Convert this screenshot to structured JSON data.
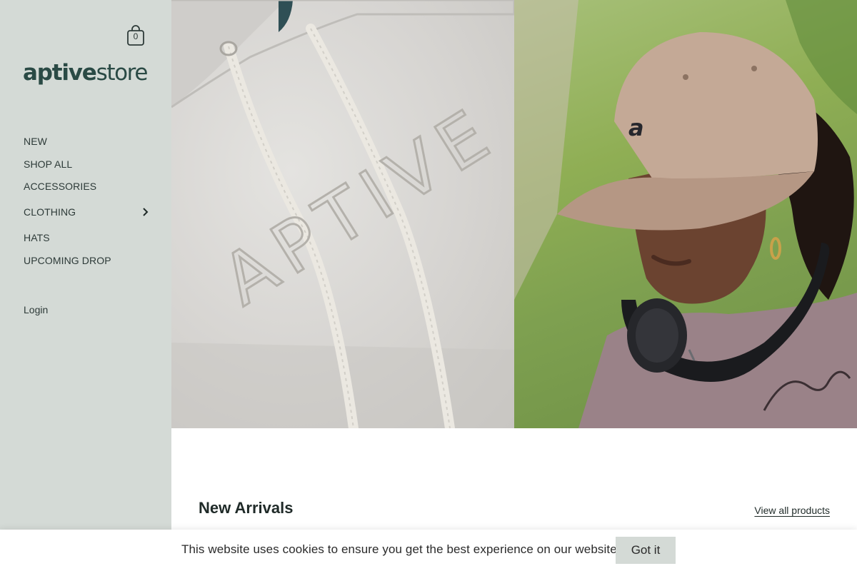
{
  "sidebar": {
    "cart_count": "0",
    "logo_bold": "aptive",
    "logo_light": "store",
    "nav": [
      {
        "label": "NEW"
      },
      {
        "label": "SHOP ALL"
      },
      {
        "label": "ACCESSORIES"
      },
      {
        "label": "CLOTHING",
        "has_submenu": true
      },
      {
        "label": "HATS"
      },
      {
        "label": "UPCOMING DROP"
      }
    ],
    "login_label": "Login"
  },
  "hero": {
    "left_image_text": "APTIVE",
    "right_cap_letter": "a"
  },
  "main": {
    "section_title": "New Arrivals",
    "view_all_label": "View all products"
  },
  "cookie": {
    "message": "This website uses cookies to ensure you get the best experience on our website.",
    "button_label": "Got it"
  },
  "colors": {
    "sidebar_bg": "#d4dad6",
    "text": "#2d3a38",
    "logo": "#2a4a45",
    "button_bg": "#d4dad6"
  }
}
